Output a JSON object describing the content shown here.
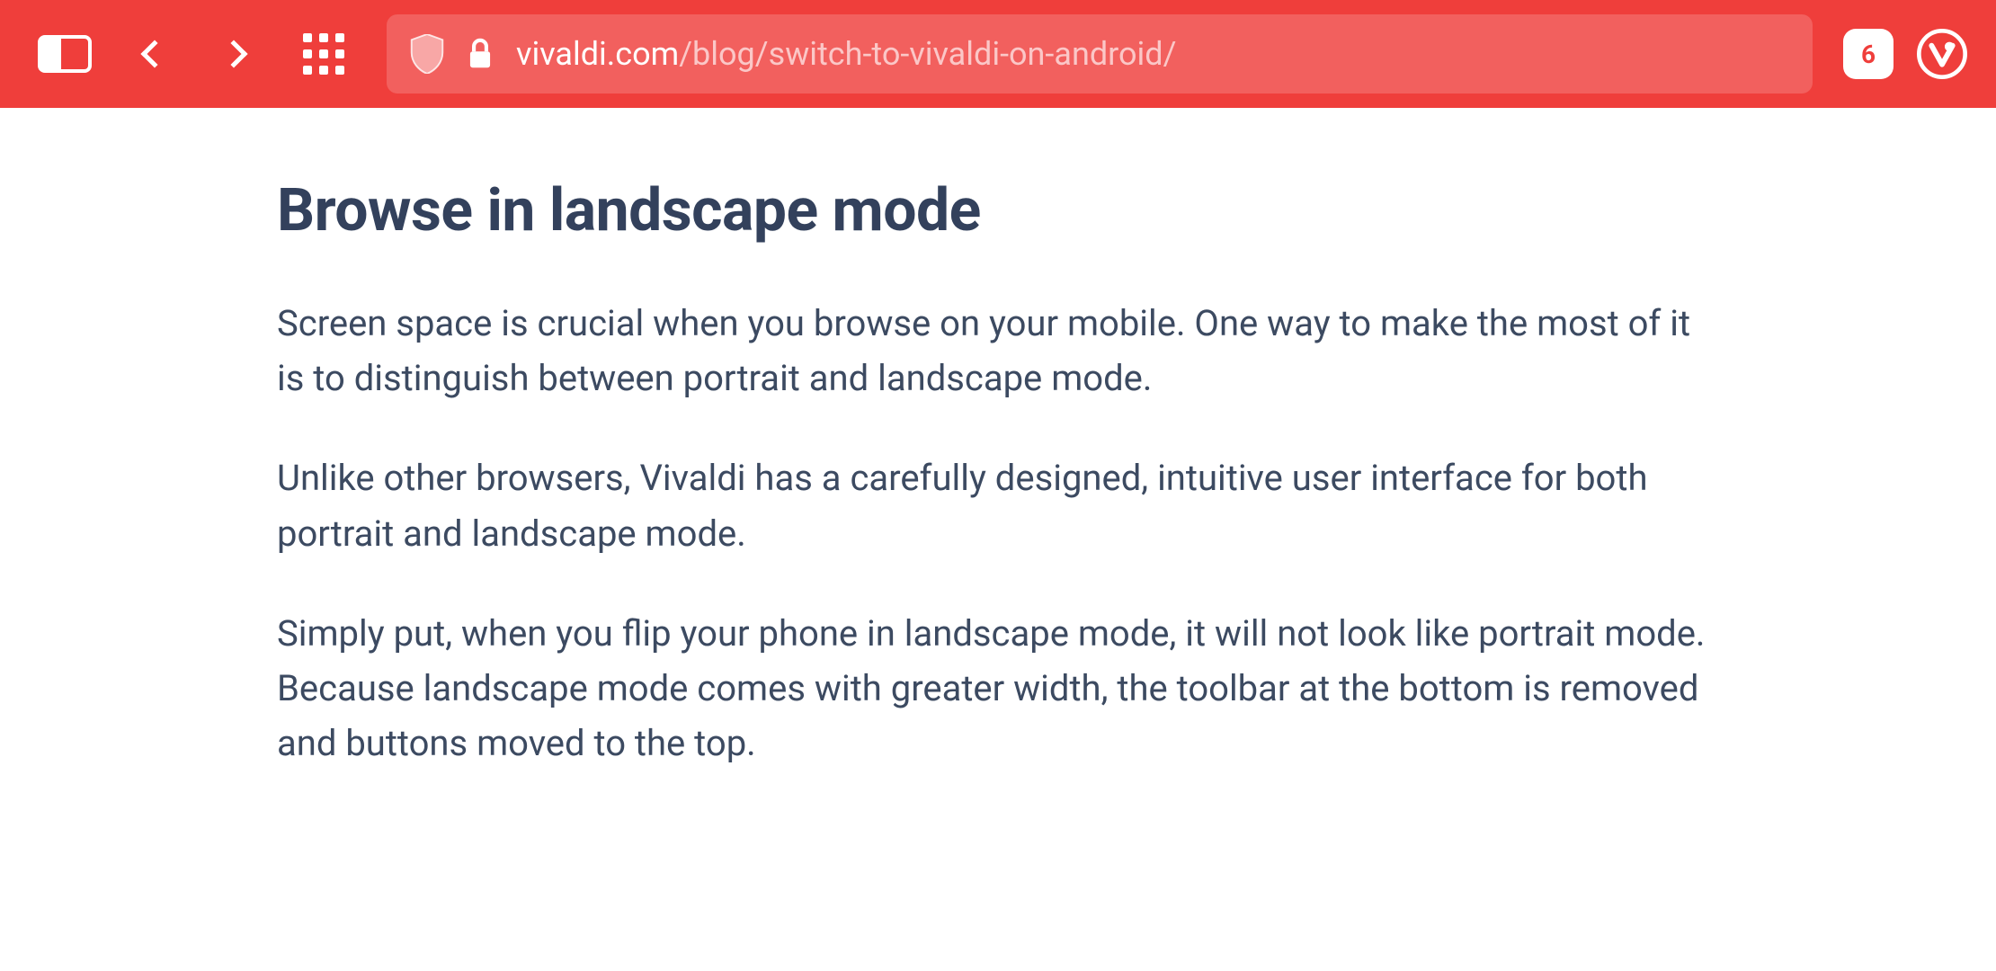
{
  "toolbar": {
    "tab_count": "6",
    "url": {
      "domain": "vivaldi.com",
      "path": "/blog/switch-to-vivaldi-on-android/"
    }
  },
  "article": {
    "heading": "Browse in landscape mode",
    "paragraphs": [
      "Screen space is crucial when you browse on your mobile. One way to make the most of it is to distinguish between portrait and landscape mode.",
      "Unlike other browsers, Vivaldi has a carefully designed, intuitive user interface for both portrait and landscape mode.",
      "Simply put, when you flip your phone in landscape mode, it will not look like portrait mode. Because landscape mode comes with greater width, the toolbar at the bottom is removed and buttons moved to the top."
    ]
  }
}
